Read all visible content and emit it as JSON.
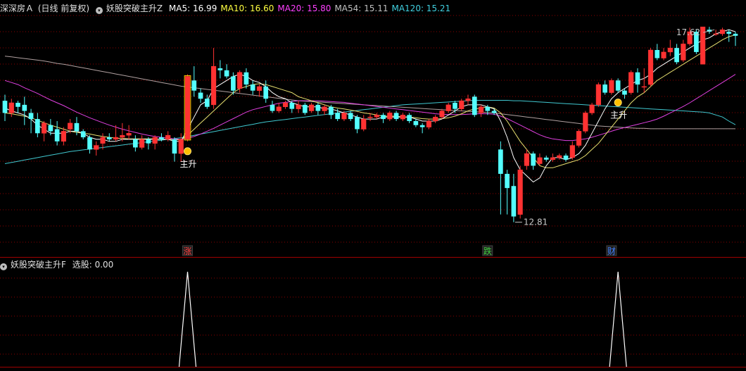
{
  "header": {
    "stock_name": "深深房Ａ",
    "period": "(日线 前复权)",
    "indicator_name": "妖股突破主升Z",
    "ma_labels": [
      {
        "label": "MA5: 16.99",
        "color": "#ffffff"
      },
      {
        "label": "MA10: 16.60",
        "color": "#ffff40"
      },
      {
        "label": "MA20: 15.80",
        "color": "#ff40ff"
      },
      {
        "label": "MA54: 15.11",
        "color": "#c0c0c0"
      },
      {
        "label": "MA120: 15.21",
        "color": "#40d0e0"
      }
    ]
  },
  "sub_header": {
    "indicator_name": "妖股突破主升F",
    "value_label": "选股: 0.00"
  },
  "colors": {
    "up": "#ff3232",
    "down": "#54ffff",
    "grid": "#8b0000",
    "ma5": "#ffffff",
    "ma10": "#e8e070",
    "ma20": "#e040e0",
    "ma54": "#b0a0a0",
    "ma120": "#40c8d0",
    "signal_line": "#ffffff"
  },
  "annotations": {
    "high_label": "17.62",
    "low_label": "12.81",
    "signal_labels": [
      "主升",
      "主升"
    ]
  },
  "event_tags": [
    {
      "label": "涨",
      "color": "#ff4040"
    },
    {
      "label": "跌",
      "color": "#40d040"
    },
    {
      "label": "财",
      "color": "#4080ff"
    }
  ],
  "chart_data": {
    "type": "candlestick",
    "y_range": [
      12.3,
      17.9
    ],
    "candles": [
      [
        15.8,
        15.5,
        15.95,
        15.3
      ],
      [
        15.5,
        15.75,
        15.85,
        15.4
      ],
      [
        15.75,
        15.65,
        15.8,
        15.5
      ],
      [
        15.7,
        15.55,
        15.9,
        15.2
      ],
      [
        15.5,
        15.35,
        15.6,
        15.0
      ],
      [
        15.35,
        15.0,
        15.5,
        14.9
      ],
      [
        15.0,
        15.25,
        15.3,
        14.8
      ],
      [
        15.2,
        15.05,
        15.35,
        14.95
      ],
      [
        15.1,
        14.8,
        15.3,
        14.7
      ],
      [
        14.8,
        15.05,
        15.15,
        14.7
      ],
      [
        15.1,
        15.25,
        15.35,
        15.0
      ],
      [
        15.25,
        15.05,
        15.4,
        14.95
      ],
      [
        15.05,
        14.9,
        15.1,
        14.85
      ],
      [
        14.9,
        14.6,
        14.95,
        14.5
      ],
      [
        14.6,
        14.7,
        14.8,
        14.45
      ],
      [
        14.75,
        14.9,
        15.0,
        14.6
      ],
      [
        14.9,
        14.85,
        15.0,
        14.8
      ],
      [
        14.85,
        14.9,
        15.2,
        14.8
      ],
      [
        14.9,
        14.95,
        15.25,
        14.8
      ],
      [
        14.95,
        15.0,
        15.2,
        14.85
      ],
      [
        14.85,
        14.65,
        14.95,
        14.55
      ],
      [
        14.65,
        14.85,
        14.95,
        14.6
      ],
      [
        14.85,
        14.75,
        14.9,
        14.6
      ],
      [
        14.75,
        14.9,
        14.95,
        14.6
      ],
      [
        14.9,
        14.85,
        15.0,
        14.8
      ],
      [
        14.85,
        14.95,
        15.05,
        14.8
      ],
      [
        14.85,
        14.5,
        14.9,
        14.3
      ],
      [
        14.5,
        14.85,
        15.0,
        14.3
      ],
      [
        14.85,
        16.4,
        16.45,
        14.8
      ],
      [
        16.3,
        16.05,
        16.65,
        15.9
      ],
      [
        16.0,
        15.85,
        16.1,
        15.75
      ],
      [
        15.85,
        15.65,
        15.95,
        15.6
      ],
      [
        15.7,
        16.65,
        17.1,
        15.6
      ],
      [
        16.6,
        16.55,
        16.8,
        16.35
      ],
      [
        16.55,
        16.4,
        16.7,
        16.35
      ],
      [
        16.4,
        16.05,
        16.5,
        15.95
      ],
      [
        16.1,
        16.5,
        16.55,
        16.0
      ],
      [
        16.5,
        16.2,
        16.6,
        16.1
      ],
      [
        16.2,
        16.05,
        16.3,
        15.95
      ],
      [
        16.05,
        16.15,
        16.2,
        15.9
      ],
      [
        16.15,
        15.85,
        16.3,
        15.75
      ],
      [
        15.7,
        15.55,
        15.8,
        15.5
      ],
      [
        15.55,
        15.65,
        15.75,
        15.5
      ],
      [
        15.65,
        15.75,
        15.8,
        15.6
      ],
      [
        15.75,
        15.6,
        15.8,
        15.5
      ],
      [
        15.6,
        15.7,
        15.8,
        15.5
      ],
      [
        15.7,
        15.5,
        15.75,
        15.45
      ],
      [
        15.55,
        15.7,
        15.75,
        15.5
      ],
      [
        15.7,
        15.55,
        15.75,
        15.45
      ],
      [
        15.55,
        15.65,
        15.7,
        15.45
      ],
      [
        15.65,
        15.45,
        15.7,
        15.35
      ],
      [
        15.5,
        15.35,
        15.6,
        15.3
      ],
      [
        15.35,
        15.5,
        15.55,
        15.3
      ],
      [
        15.5,
        15.35,
        15.55,
        15.3
      ],
      [
        15.4,
        15.1,
        15.45,
        15.0
      ],
      [
        15.1,
        15.35,
        15.45,
        15.05
      ],
      [
        15.4,
        15.4,
        15.5,
        15.3
      ],
      [
        15.4,
        15.45,
        15.5,
        15.35
      ],
      [
        15.45,
        15.35,
        15.5,
        15.25
      ],
      [
        15.35,
        15.5,
        15.55,
        15.3
      ],
      [
        15.5,
        15.35,
        15.55,
        15.3
      ],
      [
        15.35,
        15.45,
        15.5,
        15.3
      ],
      [
        15.45,
        15.3,
        15.5,
        15.25
      ],
      [
        15.3,
        15.2,
        15.35,
        15.15
      ],
      [
        15.2,
        15.15,
        15.25,
        15.0
      ],
      [
        15.15,
        15.3,
        15.35,
        15.1
      ],
      [
        15.3,
        15.4,
        15.45,
        15.25
      ],
      [
        15.4,
        15.55,
        15.6,
        15.35
      ],
      [
        15.55,
        15.7,
        15.75,
        15.5
      ],
      [
        15.75,
        15.6,
        15.8,
        15.5
      ],
      [
        15.6,
        15.8,
        15.85,
        15.55
      ],
      [
        15.8,
        15.85,
        15.95,
        15.7
      ],
      [
        15.9,
        15.45,
        15.95,
        15.4
      ],
      [
        15.5,
        15.65,
        15.7,
        15.4
      ],
      [
        15.65,
        15.55,
        15.7,
        15.45
      ],
      [
        15.55,
        15.5,
        15.6,
        15.45
      ],
      [
        14.6,
        14.0,
        14.8,
        13.0
      ],
      [
        14.0,
        13.65,
        14.1,
        13.0
      ],
      [
        13.7,
        12.95,
        14.0,
        12.81
      ],
      [
        13.0,
        14.1,
        14.2,
        12.9
      ],
      [
        14.2,
        14.5,
        14.6,
        14.1
      ],
      [
        14.5,
        14.2,
        14.55,
        14.1
      ],
      [
        14.25,
        14.4,
        14.5,
        14.2
      ],
      [
        14.4,
        14.35,
        14.45,
        14.3
      ],
      [
        14.35,
        14.4,
        14.5,
        14.3
      ],
      [
        14.4,
        14.45,
        14.5,
        14.35
      ],
      [
        14.45,
        14.35,
        14.5,
        14.3
      ],
      [
        14.4,
        14.7,
        14.8,
        14.35
      ],
      [
        14.7,
        15.05,
        15.1,
        14.65
      ],
      [
        15.05,
        15.5,
        15.55,
        15.0
      ],
      [
        15.5,
        15.7,
        15.75,
        15.45
      ],
      [
        15.7,
        16.2,
        16.25,
        15.65
      ],
      [
        16.2,
        16.0,
        16.3,
        15.95
      ],
      [
        16.0,
        16.3,
        16.35,
        15.95
      ],
      [
        16.3,
        16.05,
        16.35,
        16.0
      ],
      [
        16.05,
        15.95,
        16.1,
        15.85
      ],
      [
        16.0,
        16.5,
        16.55,
        15.95
      ],
      [
        16.5,
        16.2,
        16.6,
        16.0
      ],
      [
        16.15,
        16.15,
        16.6,
        16.0
      ],
      [
        16.2,
        17.05,
        17.1,
        16.15
      ],
      [
        17.05,
        16.85,
        17.2,
        16.8
      ],
      [
        16.85,
        17.0,
        17.1,
        16.8
      ],
      [
        17.0,
        17.1,
        17.3,
        16.9
      ],
      [
        17.1,
        16.75,
        17.2,
        16.7
      ],
      [
        16.8,
        17.2,
        17.3,
        16.75
      ],
      [
        17.2,
        17.5,
        17.6,
        17.15
      ],
      [
        17.5,
        17.0,
        17.55,
        16.95
      ],
      [
        16.7,
        17.62,
        17.62,
        16.7
      ],
      [
        17.55,
        17.5,
        17.62,
        17.45
      ],
      [
        17.45,
        17.45,
        17.55,
        17.4
      ],
      [
        17.45,
        17.55,
        17.6,
        17.4
      ],
      [
        17.5,
        17.45,
        17.55,
        17.25
      ],
      [
        17.45,
        17.4,
        17.5,
        17.15
      ]
    ],
    "ma5": [
      15.62,
      15.55,
      15.5,
      15.45,
      15.35,
      15.2,
      15.1,
      15.0,
      15.0,
      15.0,
      15.05,
      15.05,
      15.0,
      14.9,
      14.85,
      14.85,
      14.8,
      14.8,
      14.85,
      14.85,
      14.85,
      14.85,
      14.85,
      14.85,
      14.85,
      14.85,
      14.8,
      14.8,
      15.1,
      15.4,
      15.7,
      15.8,
      16.1,
      16.2,
      16.3,
      16.4,
      16.45,
      16.4,
      16.3,
      16.25,
      16.15,
      16.0,
      15.9,
      15.85,
      15.75,
      15.7,
      15.65,
      15.65,
      15.65,
      15.6,
      15.6,
      15.55,
      15.5,
      15.45,
      15.4,
      15.35,
      15.35,
      15.35,
      15.4,
      15.4,
      15.4,
      15.4,
      15.4,
      15.35,
      15.3,
      15.3,
      15.3,
      15.35,
      15.45,
      15.55,
      15.65,
      15.7,
      15.7,
      15.7,
      15.65,
      15.6,
      15.3,
      14.9,
      14.4,
      14.1,
      13.95,
      13.8,
      13.9,
      14.2,
      14.4,
      14.4,
      14.35,
      14.4,
      14.5,
      14.7,
      15.0,
      15.3,
      15.6,
      15.85,
      16.0,
      16.1,
      16.2,
      16.3,
      16.35,
      16.45,
      16.6,
      16.7,
      16.8,
      16.9,
      17.0,
      17.1,
      17.2,
      17.3,
      17.35,
      17.45,
      17.5,
      17.55,
      17.5
    ],
    "ma10": [
      15.5,
      15.48,
      15.45,
      15.42,
      15.38,
      15.32,
      15.26,
      15.2,
      15.15,
      15.1,
      15.05,
      15.02,
      15.0,
      14.98,
      14.95,
      14.92,
      14.9,
      14.88,
      14.87,
      14.86,
      14.86,
      14.86,
      14.86,
      14.86,
      14.85,
      14.85,
      14.84,
      14.84,
      14.95,
      15.1,
      15.25,
      15.4,
      15.55,
      15.7,
      15.85,
      16.0,
      16.1,
      16.15,
      16.2,
      16.22,
      16.2,
      16.15,
      16.1,
      16.05,
      16.0,
      15.9,
      15.85,
      15.8,
      15.75,
      15.7,
      15.65,
      15.62,
      15.6,
      15.57,
      15.54,
      15.5,
      15.48,
      15.45,
      15.42,
      15.42,
      15.42,
      15.4,
      15.4,
      15.38,
      15.36,
      15.35,
      15.35,
      15.36,
      15.38,
      15.42,
      15.48,
      15.55,
      15.6,
      15.62,
      15.65,
      15.62,
      15.5,
      15.3,
      15.05,
      14.8,
      14.6,
      14.4,
      14.2,
      14.15,
      14.15,
      14.2,
      14.25,
      14.3,
      14.35,
      14.45,
      14.6,
      14.75,
      14.95,
      15.15,
      15.35,
      15.55,
      15.75,
      15.9,
      16.0,
      16.15,
      16.3,
      16.4,
      16.5,
      16.6,
      16.7,
      16.8,
      16.9,
      17.0,
      17.1,
      17.2,
      17.3,
      17.38,
      17.42
    ],
    "ma20": [
      16.3,
      16.25,
      16.2,
      16.12,
      16.05,
      15.98,
      15.9,
      15.82,
      15.75,
      15.68,
      15.6,
      15.52,
      15.45,
      15.38,
      15.32,
      15.26,
      15.2,
      15.15,
      15.1,
      15.06,
      15.02,
      14.98,
      14.95,
      14.92,
      14.9,
      14.88,
      14.86,
      14.85,
      14.88,
      14.92,
      14.98,
      15.05,
      15.12,
      15.2,
      15.28,
      15.36,
      15.44,
      15.52,
      15.58,
      15.62,
      15.66,
      15.7,
      15.74,
      15.76,
      15.78,
      15.8,
      15.8,
      15.8,
      15.8,
      15.79,
      15.78,
      15.77,
      15.76,
      15.74,
      15.72,
      15.7,
      15.68,
      15.66,
      15.64,
      15.62,
      15.6,
      15.58,
      15.56,
      15.54,
      15.52,
      15.5,
      15.48,
      15.47,
      15.46,
      15.46,
      15.46,
      15.47,
      15.48,
      15.48,
      15.48,
      15.47,
      15.42,
      15.36,
      15.28,
      15.2,
      15.12,
      15.04,
      14.96,
      14.9,
      14.86,
      14.84,
      14.82,
      14.82,
      14.84,
      14.86,
      14.9,
      14.95,
      15.0,
      15.05,
      15.1,
      15.14,
      15.18,
      15.22,
      15.26,
      15.3,
      15.35,
      15.42,
      15.5,
      15.58,
      15.66,
      15.75,
      15.85,
      15.95,
      16.05,
      16.15,
      16.25,
      16.35,
      16.45
    ],
    "ma54": [
      16.9,
      16.88,
      16.86,
      16.84,
      16.82,
      16.8,
      16.78,
      16.75,
      16.72,
      16.7,
      16.67,
      16.64,
      16.61,
      16.58,
      16.55,
      16.52,
      16.49,
      16.46,
      16.43,
      16.4,
      16.37,
      16.34,
      16.31,
      16.28,
      16.25,
      16.22,
      16.19,
      16.16,
      16.14,
      16.12,
      16.1,
      16.08,
      16.06,
      16.04,
      16.02,
      16.0,
      15.98,
      15.96,
      15.94,
      15.92,
      15.9,
      15.88,
      15.86,
      15.84,
      15.82,
      15.8,
      15.79,
      15.78,
      15.77,
      15.76,
      15.75,
      15.74,
      15.73,
      15.72,
      15.71,
      15.7,
      15.69,
      15.68,
      15.67,
      15.66,
      15.65,
      15.64,
      15.63,
      15.62,
      15.61,
      15.6,
      15.59,
      15.58,
      15.57,
      15.56,
      15.55,
      15.54,
      15.53,
      15.52,
      15.51,
      15.5,
      15.48,
      15.46,
      15.44,
      15.42,
      15.4,
      15.38,
      15.36,
      15.34,
      15.32,
      15.3,
      15.28,
      15.26,
      15.24,
      15.22,
      15.2,
      15.18,
      15.17,
      15.16,
      15.15,
      15.14,
      15.13,
      15.12,
      15.12,
      15.11,
      15.11,
      15.11,
      15.11,
      15.11,
      15.11,
      15.11,
      15.11,
      15.11,
      15.11,
      15.11,
      15.11,
      15.11,
      15.11
    ],
    "ma120": [
      14.25,
      14.28,
      14.31,
      14.34,
      14.37,
      14.4,
      14.43,
      14.46,
      14.49,
      14.52,
      14.55,
      14.57,
      14.59,
      14.61,
      14.63,
      14.65,
      14.67,
      14.69,
      14.71,
      14.73,
      14.75,
      14.77,
      14.79,
      14.81,
      14.83,
      14.85,
      14.87,
      14.89,
      14.92,
      14.95,
      14.98,
      15.01,
      15.04,
      15.07,
      15.1,
      15.13,
      15.16,
      15.19,
      15.22,
      15.25,
      15.28,
      15.3,
      15.32,
      15.34,
      15.36,
      15.38,
      15.4,
      15.42,
      15.44,
      15.46,
      15.48,
      15.5,
      15.52,
      15.54,
      15.56,
      15.58,
      15.6,
      15.62,
      15.64,
      15.66,
      15.68,
      15.7,
      15.71,
      15.72,
      15.73,
      15.74,
      15.75,
      15.76,
      15.77,
      15.78,
      15.79,
      15.8,
      15.81,
      15.81,
      15.81,
      15.81,
      15.81,
      15.81,
      15.8,
      15.8,
      15.79,
      15.78,
      15.77,
      15.76,
      15.75,
      15.74,
      15.73,
      15.72,
      15.71,
      15.7,
      15.69,
      15.68,
      15.67,
      15.66,
      15.65,
      15.64,
      15.63,
      15.62,
      15.61,
      15.6,
      15.59,
      15.58,
      15.57,
      15.56,
      15.55,
      15.54,
      15.53,
      15.52,
      15.5,
      15.45,
      15.4,
      15.3,
      15.21
    ],
    "signal_marks": [
      28,
      94
    ],
    "event_tag_positions": [
      28,
      74,
      93
    ],
    "high_index": 109,
    "low_index": 78,
    "sub_chart": {
      "label": "选股",
      "value": 0.0,
      "spike_indices": [
        28,
        94
      ],
      "spike_value": 1
    }
  }
}
